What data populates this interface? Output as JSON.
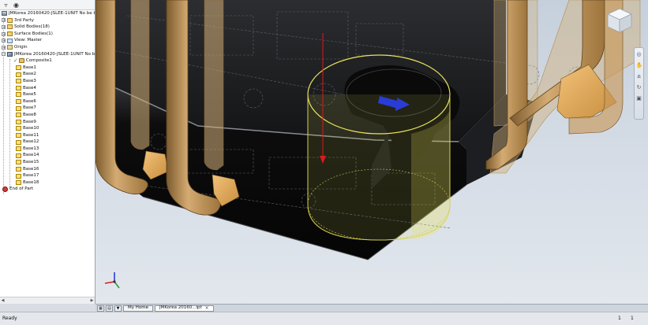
{
  "tree": {
    "root": "JMKorea 20160420-JSLEE-1UNIT No be bet",
    "items": [
      {
        "label": "3rd Party"
      },
      {
        "label": "Solid Bodies(18)"
      },
      {
        "label": "Surface Bodies(1)"
      },
      {
        "label": "View: Master"
      },
      {
        "label": "Origin"
      },
      {
        "label": "JMKorea 20160420-JSLEE-1UNIT No be"
      }
    ],
    "composite": "Composite1",
    "bases": [
      "Base1",
      "Base2",
      "Base3",
      "Base4",
      "Base5",
      "Base6",
      "Base7",
      "Base8",
      "Base9",
      "Base10",
      "Base11",
      "Base12",
      "Base13",
      "Base14",
      "Base15",
      "Base16",
      "Base17",
      "Base18"
    ],
    "end": "End of Part"
  },
  "tabs": {
    "home": "My Home",
    "doc": "JMKorea 20160...ipt"
  },
  "status": {
    "text": "Ready",
    "a": "1",
    "b": "1"
  },
  "icons": {
    "filter": "filter-icon",
    "search": "binoculars-icon"
  },
  "colors": {
    "part_body": "#1a1b1d",
    "clip": "#c9a06a",
    "selection": "#e8e35a",
    "arrow_red": "#d81c1c",
    "arrow_blue": "#2a3cd6"
  }
}
